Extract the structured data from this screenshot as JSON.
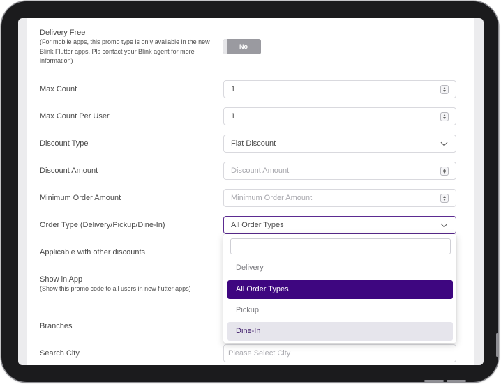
{
  "form": {
    "delivery_free": {
      "label": "Delivery Free",
      "note": "(For mobile apps, this promo type is only available in the new Blink Flutter apps. Pls contact your Blink agent for more information)",
      "toggle_label": "No"
    },
    "max_count": {
      "label": "Max Count",
      "value": "1"
    },
    "max_count_per_user": {
      "label": "Max Count Per User",
      "value": "1"
    },
    "discount_type": {
      "label": "Discount Type",
      "value": "Flat Discount"
    },
    "discount_amount": {
      "label": "Discount Amount",
      "placeholder": "Discount Amount"
    },
    "minimum_order_amount": {
      "label": "Minimum Order Amount",
      "placeholder": "Minimum Order Amount"
    },
    "order_type": {
      "label": "Order Type (Delivery/Pickup/Dine-In)",
      "value": "All Order Types",
      "options": [
        {
          "label": "Delivery",
          "state": "normal"
        },
        {
          "label": "All Order Types",
          "state": "selected"
        },
        {
          "label": "Pickup",
          "state": "normal"
        },
        {
          "label": "Dine-In",
          "state": "hover"
        }
      ]
    },
    "applicable_with_other_discounts": {
      "label": "Applicable with other discounts"
    },
    "show_in_app": {
      "label": "Show in App",
      "note": "(Show this promo code to all users in new flutter apps)"
    },
    "branches": {
      "label": "Branches"
    },
    "search_city": {
      "label": "Search City",
      "placeholder": "Please Select City"
    }
  },
  "colors": {
    "accent": "#3e0680",
    "focus_border": "#5b2b91",
    "hover_option": "#e6e5ec",
    "toggle_off": "#9a9aa0"
  },
  "icons": {
    "stepper": "number-stepper-icon",
    "chevron": "chevron-down-icon"
  }
}
